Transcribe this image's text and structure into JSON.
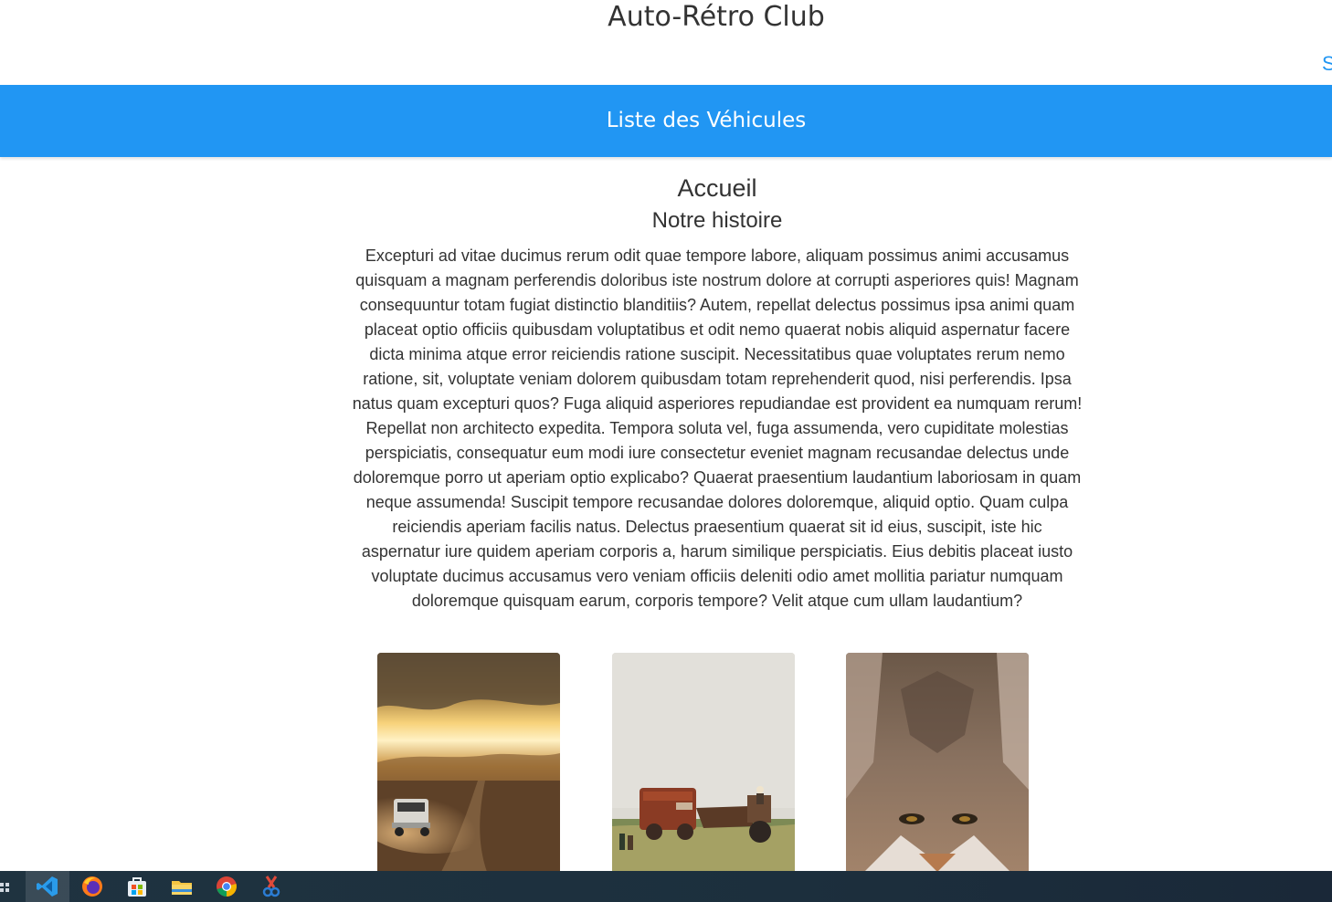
{
  "header": {
    "site_title": "Auto-Rétro Club",
    "cut_link_text": "S"
  },
  "nav": {
    "vehicles_link": "Liste des Véhicules"
  },
  "main": {
    "page_title": "Accueil",
    "section_title": "Notre histoire",
    "paragraph": "Excepturi ad vitae ducimus rerum odit quae tempore labore, aliquam possimus animi accusamus quisquam a magnam perferendis doloribus iste nostrum dolore at corrupti asperiores quis! Magnam consequuntur totam fugiat distinctio blanditiis? Autem, repellat delectus possimus ipsa animi quam placeat optio officiis quibusdam voluptatibus et odit nemo quaerat nobis aliquid aspernatur facere dicta minima atque error reiciendis ratione suscipit. Necessitatibus quae voluptates rerum nemo ratione, sit, voluptate veniam dolorem quibusdam totam reprehenderit quod, nisi perferendis. Ipsa natus quam excepturi quos? Fuga aliquid asperiores repudiandae est provident ea numquam rerum! Repellat non architecto expedita. Tempora soluta vel, fuga assumenda, vero cupiditate molestias perspiciatis, consequatur eum modi iure consectetur eveniet magnam recusandae delectus unde doloremque porro ut aperiam optio explicabo? Quaerat praesentium laudantium laboriosam in quam neque assumenda! Suscipit tempore recusandae dolores doloremque, aliquid optio. Quam culpa reiciendis aperiam facilis natus. Delectus praesentium quaerat sit id eius, suscipit, iste hic aspernatur iure quidem aperiam corporis a, harum similique perspiciatis. Eius debitis placeat iusto voluptate ducimus accusamus vero veniam officiis deleniti odio amet mollitia pariatur numquam doloremque quisquam earum, corporis tempore? Velit atque cum ullam laudantium?",
    "gallery": [
      {
        "subject": "van-driving-at-sunset-photo"
      },
      {
        "subject": "hay-baler-tractor-photo"
      },
      {
        "subject": "coyote-face-photo"
      }
    ]
  },
  "taskbar": {
    "items": [
      {
        "icon": "vscode-icon",
        "active": true
      },
      {
        "icon": "firefox-icon",
        "active": false
      },
      {
        "icon": "microsoft-store-icon",
        "active": false
      },
      {
        "icon": "file-explorer-icon",
        "active": false
      },
      {
        "icon": "chrome-icon",
        "active": false
      },
      {
        "icon": "snipping-tool-icon",
        "active": false
      }
    ]
  },
  "colors": {
    "nav_background": "#2196f3",
    "link": "#2196f3",
    "text": "#333333",
    "taskbar": "#1f3340"
  }
}
